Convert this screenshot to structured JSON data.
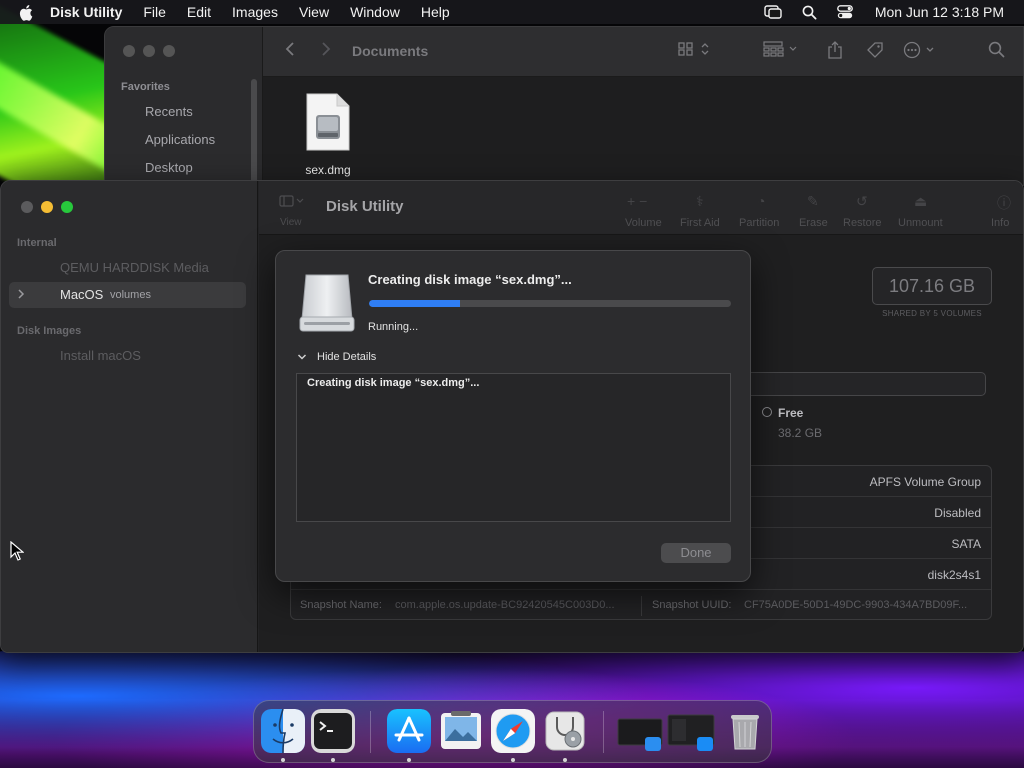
{
  "menubar": {
    "app_name": "Disk Utility",
    "menus": [
      "File",
      "Edit",
      "Images",
      "View",
      "Window",
      "Help"
    ],
    "clock": "Mon Jun 12  3:18 PM"
  },
  "finder": {
    "title": "Documents",
    "sidebar_section": "Favorites",
    "sidebar_items": [
      "Recents",
      "Applications",
      "Desktop"
    ],
    "file_name": "sex.dmg"
  },
  "disk_utility": {
    "title": "Disk Utility",
    "toolbar": {
      "view_label": "View",
      "tools": [
        "Volume",
        "First Aid",
        "Partition",
        "Erase",
        "Restore",
        "Unmount",
        "Info"
      ]
    },
    "sidebar": {
      "internal_title": "Internal",
      "internal_item": "QEMU HARDDISK Media",
      "selected_item": "MacOS",
      "selected_sub": "volumes",
      "disk_images_title": "Disk Images",
      "disk_images_item": "Install macOS"
    },
    "capacity": "107.16 GB",
    "capacity_sub": "SHARED BY 5 VOLUMES",
    "legend": {
      "label": "Free",
      "value": "38.2 GB"
    },
    "info_values": [
      "APFS Volume Group",
      "Disabled",
      "SATA",
      "disk2s4s1"
    ],
    "snapshot_name_label": "Snapshot Name:",
    "snapshot_name_value": "com.apple.os.update-BC92420545C003D0...",
    "snapshot_uuid_label": "Snapshot UUID:",
    "snapshot_uuid_value": "CF75A0DE-50D1-49DC-9903-434A7BD09F..."
  },
  "sheet": {
    "heading": "Creating disk image “sex.dmg”...",
    "progress": 0.25,
    "status": "Running...",
    "details_toggle": "Hide Details",
    "log_line": "Creating disk image “sex.dmg”...",
    "done_label": "Done"
  },
  "dock": {
    "apps": [
      "Finder",
      "Terminal",
      "App Store",
      "Preview",
      "Safari",
      "Disk Utility"
    ],
    "colors": {
      "finder": "#2b8ef0",
      "terminal": "#1d1d1f",
      "appstore": "#1a8cf5",
      "safari": "#1f9bf2"
    }
  },
  "colors": {
    "accent": "#2f7ef5",
    "traffic_close": "#5b5b5d",
    "traffic_min": "#f5bd34",
    "traffic_max": "#27c83c"
  }
}
